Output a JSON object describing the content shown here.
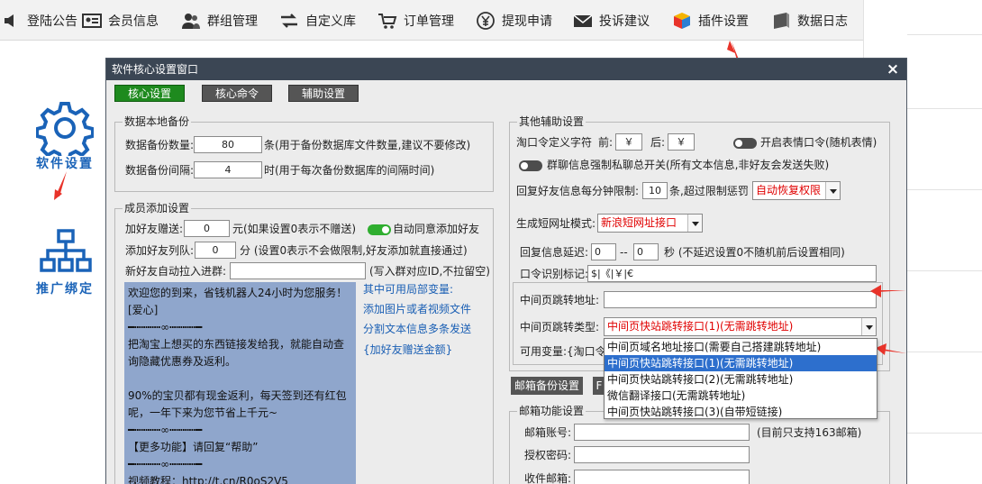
{
  "topnav": [
    {
      "label": "登陆公告",
      "icon": "speaker-icon"
    },
    {
      "label": "会员信息",
      "icon": "id-card-icon"
    },
    {
      "label": "群组管理",
      "icon": "users-icon"
    },
    {
      "label": "自定义库",
      "icon": "arrows-icon"
    },
    {
      "label": "订单管理",
      "icon": "cart-icon"
    },
    {
      "label": "提现申请",
      "icon": "yen-coin-icon"
    },
    {
      "label": "投诉建议",
      "icon": "mail-icon"
    },
    {
      "label": "插件设置",
      "icon": "cube-icon"
    },
    {
      "label": "数据日志",
      "icon": "database-icon"
    }
  ],
  "side": {
    "software_settings": "软件设置",
    "promotion_bind": "推广绑定"
  },
  "dialog": {
    "title": "软件核心设置窗口",
    "close": "×",
    "tabs": [
      "核心设置",
      "核心命令",
      "辅助设置"
    ],
    "backup": {
      "title": "数据本地备份",
      "count_label": "数据备份数量:",
      "count_value": "80",
      "count_hint": "条(用于备份数据库文件数量,建议不要修改)",
      "interval_label": "数据备份间隔:",
      "interval_value": "4",
      "interval_hint": "时(用于每次备份数据库的间隔时间)"
    },
    "member": {
      "title": "成员添加设置",
      "gift_label": "加好友赠送:",
      "gift_value": "0",
      "gift_hint": "元(如果设置0表示不赠送)",
      "auto_agree": "自动同意添加好友",
      "queue_label": "添加好友列队:",
      "queue_value": "0",
      "queue_hint": "分 (设置0表示不会做限制,好友添加就直接通过)",
      "autojoin_label": "新好友自动拉入进群:",
      "autojoin_value": "",
      "autojoin_hint": "(写入群对应ID,不拉留空)",
      "welcome_lines": [
        "欢迎您的到来，省钱机器人24小时为您服务！[爱心]",
        "━┅┅┅┅∞┅┅┅┅━",
        "把淘宝上想买的东西链接发给我，就能自动查询隐藏优惠券及返利。",
        "",
        "90%的宝贝都有现金返利，每天签到还有红包呢，一年下来为您节省上千元~",
        "━┅┅┅┅∞┅┅┅┅━",
        "【更多功能】请回复“帮助”",
        "━┅┅┅┅∞┅┅┅┅━",
        "视频教程：http://t.cn/R0oS2V5"
      ],
      "vars_title": "其中可用局部变量:",
      "var_links": [
        "添加图片或者视频文件",
        "分割文本信息多条发送",
        "{加好友赠送金额}"
      ]
    },
    "other": {
      "title": "其他辅助设置",
      "tkl_label": "淘口令定义字符",
      "front_label": "前:",
      "front_value": "￥",
      "back_label": "后:",
      "back_value": "￥",
      "emoji_label": "开启表情口令(随机表情)",
      "group_private_label": "群聊信息强制私聊总开关(所有文本信息,非好友会发送失败)",
      "limit_label": "回复好友信息每分钟限制:",
      "limit_value": "10",
      "limit_hint": "条,超过限制惩罚",
      "penalty_value": "自动恢复权限",
      "shorturl_label": "生成短网址模式:",
      "shorturl_value": "新浪短网址接口",
      "delay_label": "回复信息延迟:",
      "delay_from": "0",
      "delay_sep": "--",
      "delay_to": "0",
      "delay_hint": "秒 (不延迟设置0不随机前后设置相同)",
      "marks_label": "口令识别标记:",
      "marks_value": "$|《|￥|€",
      "mid_addr_label": "中间页跳转地址:",
      "mid_addr_value": "",
      "mid_type_label": "中间页跳转类型:",
      "mid_type_value": "中间页快站跳转接口(1)(无需跳转地址)",
      "vars_label": "可用变量:{淘口令",
      "dropdown_options": [
        "中间页域名地址接口(需要自己搭建跳转地址)",
        "中间页快站跳转接口(1)(无需跳转地址)",
        "中间页快站跳转接口(2)(无需跳转地址)",
        "微信翻译接口(无需跳转地址)",
        "中间页快站跳转接口(3)(自带短链接)"
      ]
    },
    "mail": {
      "backup_btn": "邮箱备份设置",
      "second_btn": "F",
      "title": "邮箱功能设置",
      "account_label": "邮箱账号:",
      "account_value": "",
      "account_hint": "(目前只支持163邮箱)",
      "auth_label": "授权密码:",
      "auth_value": "",
      "receive_label": "收件邮箱:",
      "receive_value": ""
    }
  },
  "colors": {
    "titlebar": "#3b4654",
    "active_tab": "#1e8a1e",
    "accent_blue": "#1a63b8",
    "arrow_red": "#e8332a"
  }
}
